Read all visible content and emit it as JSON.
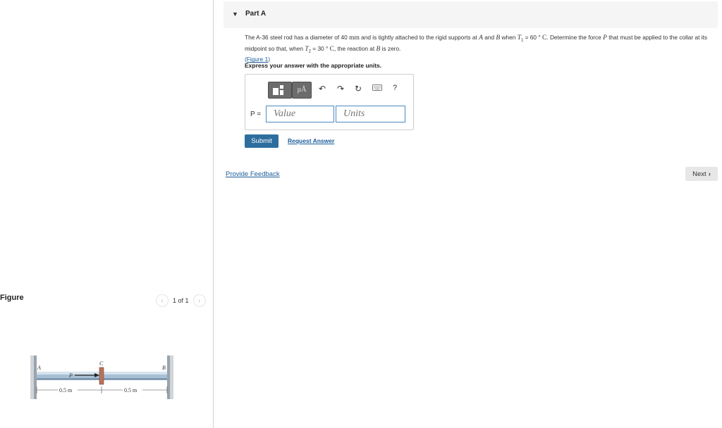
{
  "figure_panel": {
    "title": "Figure",
    "pager_text": "1 of 1",
    "prev_icon": "chevron-left-icon",
    "next_icon": "chevron-right-icon",
    "diagram": {
      "label_a": "A",
      "label_b": "B",
      "label_c": "C",
      "label_p": "P",
      "dim_left": "0.5 m",
      "dim_right": "0.5 m"
    }
  },
  "part": {
    "title": "Part A",
    "caret_icon": "triangle-down-icon"
  },
  "problem": {
    "seg1": "The A-36 steel rod has a diameter of 40",
    "unit_mm": "mm",
    "seg2": "and is tightly attached to the rigid supports at",
    "var_a": "A",
    "seg3": "and",
    "var_b": "B",
    "seg4": "when",
    "var_t1": "T",
    "sub_1": "1",
    "seg5": "= 60",
    "deg": "°",
    "unit_c": "C",
    "seg6": ". Determine the force",
    "var_p": "P",
    "seg7": "that must be applied to the collar at its midpoint so that, when",
    "var_t2": "T",
    "sub_2": "2",
    "seg8": "= 30",
    "deg2": "°",
    "unit_c2": "C",
    "seg9": ", the reaction at",
    "var_b2": "B",
    "seg10": "is zero.",
    "figure_link_open": "(",
    "figure_link": "Figure 1",
    "figure_link_close": ")"
  },
  "instructions": "Express your answer with the appropriate units.",
  "toolbar": {
    "template_icon": "template-icon",
    "units_label": "µÅ",
    "undo_icon": "undo-icon",
    "redo_icon": "redo-icon",
    "reset_icon": "reset-icon",
    "keyboard_icon": "keyboard-icon",
    "help_label": "?"
  },
  "answer": {
    "p_label": "P =",
    "value_placeholder": "Value",
    "units_placeholder": "Units"
  },
  "actions": {
    "submit_label": "Submit",
    "request_label": "Request Answer"
  },
  "feedback_label": "Provide Feedback",
  "next_label": "Next",
  "colors": {
    "accent_blue": "#2e6e9e",
    "link_blue": "#1a5c9a",
    "field_border": "#4a8bbf"
  }
}
